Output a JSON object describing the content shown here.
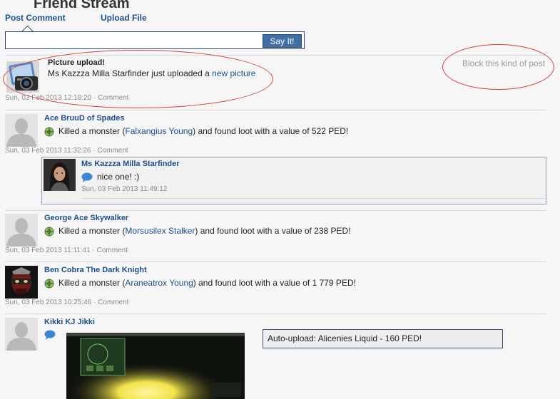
{
  "header": {
    "title": "Friend Stream",
    "tab_post": "Post Comment",
    "tab_upload": "Upload File"
  },
  "composer": {
    "placeholder": "",
    "button": "Say It!"
  },
  "posts": [
    {
      "heading": "Picture upload!",
      "text_before": "Ms Kazzza Milla Starfinder just uploaded a ",
      "link": "new picture",
      "meta": "Sun, 03 Feb 2013 12:18:20",
      "comment": "Comment",
      "block_label": "Block this kind of post"
    },
    {
      "name": "Ace BruuD of Spades",
      "text_before": "Killed a monster (",
      "monster": "Falxangius Young",
      "text_after": ") and found loot with a value of 522 PED!",
      "meta": "Sun, 03 Feb 2013 11:32:26",
      "comment": "Comment",
      "reply": {
        "name": "Ms Kazzza Milla Starfinder",
        "text": "nice one! :)",
        "meta": "Sun, 03 Feb 2013 11:49:12"
      }
    },
    {
      "name": "George Ace Skywalker",
      "text_before": "Killed a monster (",
      "monster": "Morsusilex Stalker",
      "text_after": ") and found loot with a value of 238 PED!",
      "meta": "Sun, 03 Feb 2013 11:11:41",
      "comment": "Comment"
    },
    {
      "name": "Ben Cobra The Dark Knight",
      "text_before": "Killed a monster (",
      "monster": "Araneatrox Young",
      "text_after": ") and found loot with a value of 1 779 PED!",
      "meta": "Sun, 03 Feb 2013 10:25:46",
      "comment": "Comment"
    },
    {
      "name": "Kikki KJ Jikki",
      "autoupload": "Auto-upload: Alicenies Liquid - 160 PED!"
    }
  ],
  "meta_separator": " · ",
  "colors": {
    "link": "#1c4f8e",
    "annotation": "#d44040",
    "button": "#3f6fa5"
  }
}
